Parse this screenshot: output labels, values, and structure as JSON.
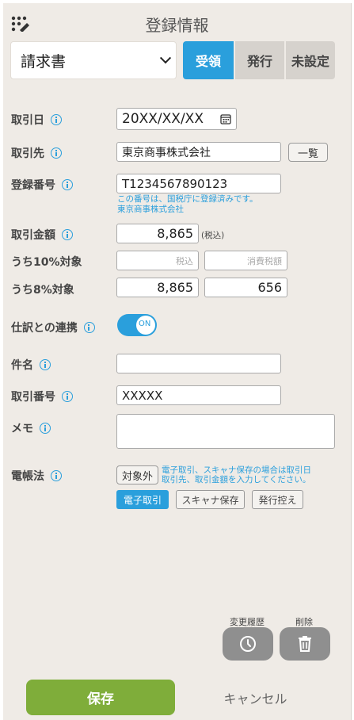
{
  "header": {
    "title": "登録情報"
  },
  "doc_type": {
    "selected": "請求書"
  },
  "direction_tabs": [
    {
      "label": "受領",
      "active": true
    },
    {
      "label": "発行",
      "active": false
    },
    {
      "label": "未設定",
      "active": false
    }
  ],
  "fields": {
    "date": {
      "label": "取引日",
      "value": "20XX/XX/XX"
    },
    "partner": {
      "label": "取引先",
      "value": "東京商事株式会社",
      "button": "一覧"
    },
    "reg_no": {
      "label": "登録番号",
      "value": "T1234567890123",
      "note_line1": "この番号は、国税庁に登録済みです。",
      "note_line2": "東京商事株式会社"
    },
    "amount": {
      "label": "取引金額",
      "value": "8,865",
      "unit": "(税込)"
    },
    "rate10": {
      "label": "うち10%対象",
      "placeholder_incl": "税込",
      "placeholder_tax": "消費税額"
    },
    "rate8": {
      "label": "うち8%対象",
      "value_incl": "8,865",
      "value_tax": "656"
    },
    "journal": {
      "label": "仕訳との連携",
      "toggle_text": "ON"
    },
    "subject": {
      "label": "件名",
      "value": ""
    },
    "txn_no": {
      "label": "取引番号",
      "value": "XXXXX"
    },
    "memo": {
      "label": "メモ",
      "value": ""
    },
    "ebook": {
      "label": "電帳法",
      "exempt_button": "対象外",
      "note_line1": "電子取引、スキャナ保存の場合は取引日",
      "note_line2": "取引先、取引金額を入力してください。",
      "chips": [
        "電子取引",
        "スキャナ保存",
        "発行控え"
      ]
    }
  },
  "actions": {
    "history_label": "変更履歴",
    "delete_label": "削除"
  },
  "footer": {
    "save": "保存",
    "cancel": "キャンセル"
  },
  "colors": {
    "accent": "#2a9fdc",
    "save": "#7fad3a",
    "panel": "#efebe6"
  }
}
